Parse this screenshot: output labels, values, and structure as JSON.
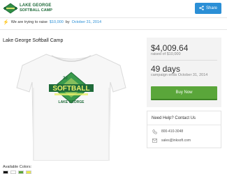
{
  "header": {
    "logo_line1": "LAKE GEORGE",
    "logo_line2": "SOFTBALL CAMP",
    "share_label": "Share"
  },
  "raise": {
    "prefix": "We are trying to raise",
    "goal": "$10,000",
    "by": "by",
    "date": "October 31, 2014"
  },
  "campaign": {
    "title": "Lake George Softball Camp"
  },
  "product": {
    "shirt_top_text": "20",
    "shirt_main_text": "SOFTBALL",
    "shirt_bottom_text": "LAKE GEORGE"
  },
  "stats": {
    "amount": "$4,009.64",
    "amount_sub": "raised of $10,000",
    "days": "49 days",
    "days_sub": "campaign ends October 31, 2014",
    "buy_label": "Buy Now"
  },
  "help": {
    "title": "Need Help? Contact Us",
    "phone": "800-410-3048",
    "email": "sales@inksoft.com"
  },
  "colors": {
    "label": "Available Colors:",
    "swatches": [
      "#111111",
      "#ffffff",
      "#5aa63a",
      "#e8e84a"
    ]
  }
}
